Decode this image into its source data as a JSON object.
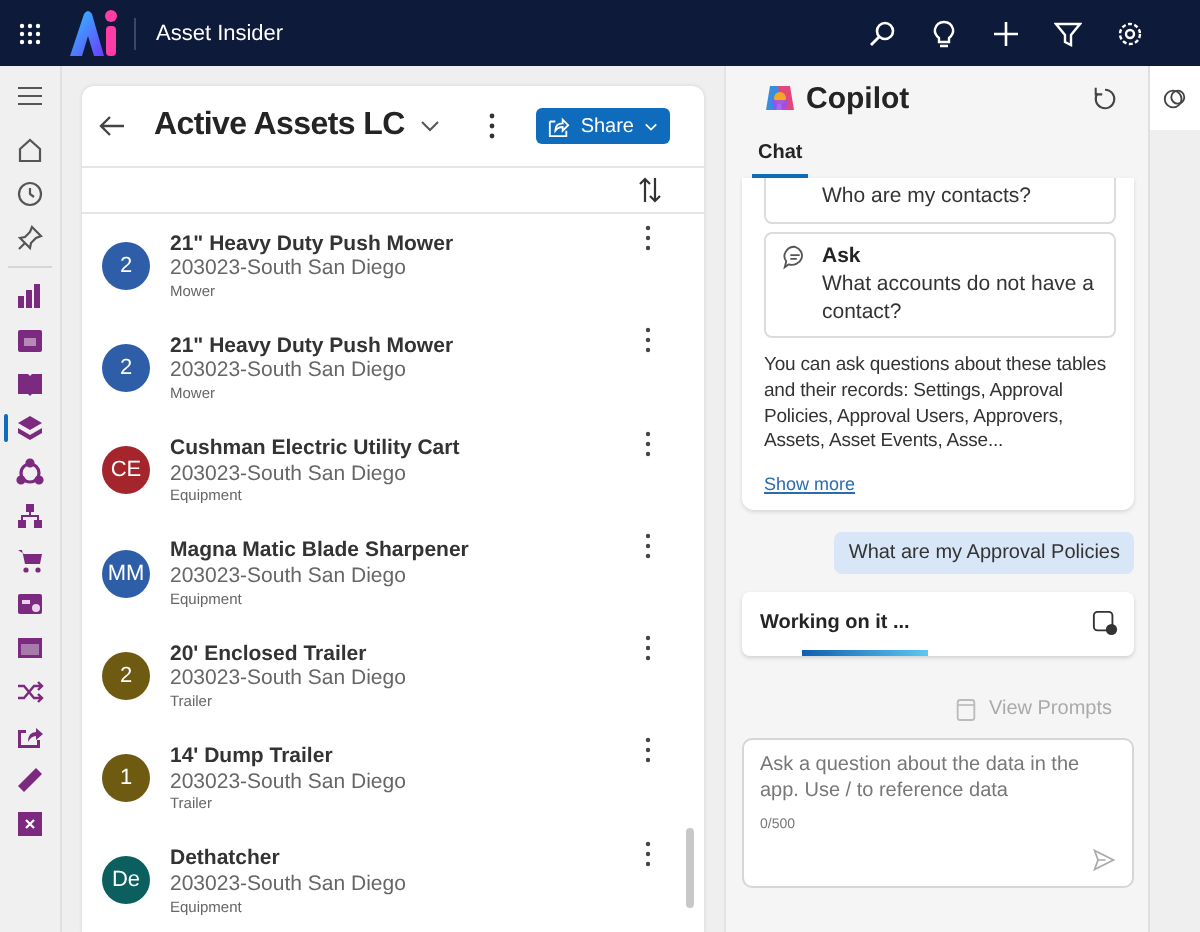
{
  "app": {
    "title": "Asset Insider"
  },
  "nav_rail": {
    "items": [
      {
        "selected": false
      },
      {
        "selected": false
      },
      {
        "selected": false
      },
      {
        "selected": false
      },
      {
        "selected": false
      },
      {
        "selected": false
      },
      {
        "selected": true
      },
      {
        "selected": false
      },
      {
        "selected": false
      },
      {
        "selected": false
      },
      {
        "selected": false
      },
      {
        "selected": false
      },
      {
        "selected": false
      },
      {
        "selected": false
      },
      {
        "selected": false
      },
      {
        "selected": false
      }
    ]
  },
  "list_view": {
    "title": "Active Assets LC",
    "share_button": "Share",
    "rows": [
      {
        "initials": "2",
        "color": "#2f5ea8",
        "title": "21\" Heavy Duty Push Mower",
        "location": "203023-South San Diego",
        "category": "Mower"
      },
      {
        "initials": "2",
        "color": "#2f5ea8",
        "title": "21\" Heavy Duty Push Mower",
        "location": "203023-South San Diego",
        "category": "Mower"
      },
      {
        "initials": "CE",
        "color": "#a4262c",
        "title": "Cushman Electric Utility Cart",
        "location": "203023-South San Diego",
        "category": "Equipment"
      },
      {
        "initials": "MM",
        "color": "#2f5ea8",
        "title": "Magna Matic Blade Sharpener",
        "location": "203023-South San Diego",
        "category": "Equipment"
      },
      {
        "initials": "2",
        "color": "#6f5a12",
        "title": "20' Enclosed Trailer",
        "location": "203023-South San Diego",
        "category": "Trailer"
      },
      {
        "initials": "1",
        "color": "#6f5a12",
        "title": "14' Dump Trailer",
        "location": "203023-South San Diego",
        "category": "Trailer"
      },
      {
        "initials": "De",
        "color": "#0b5f5f",
        "title": "Dethatcher",
        "location": "203023-South San Diego",
        "category": "Equipment"
      }
    ]
  },
  "copilot": {
    "title": "Copilot",
    "tabs": [
      {
        "label": "Chat",
        "selected": true
      }
    ],
    "suggestions": [
      {
        "text": "Who are my contacts?"
      },
      {
        "label": "Ask",
        "text": "What accounts do not have a contact?"
      }
    ],
    "intro": "You can ask questions about these tables and their records: Settings, Approval Policies, Approval Users, Approvers, Assets, Asset Events, Asse...",
    "show_more": "Show more",
    "user_message": "What are my Approval Policies",
    "status": "Working on it ...",
    "progress": {
      "level": 0.33
    },
    "view_prompts": "View Prompts",
    "input": {
      "placeholder": "Ask a question about the data in the app. Use / to reference data",
      "counter": "0/500"
    }
  }
}
